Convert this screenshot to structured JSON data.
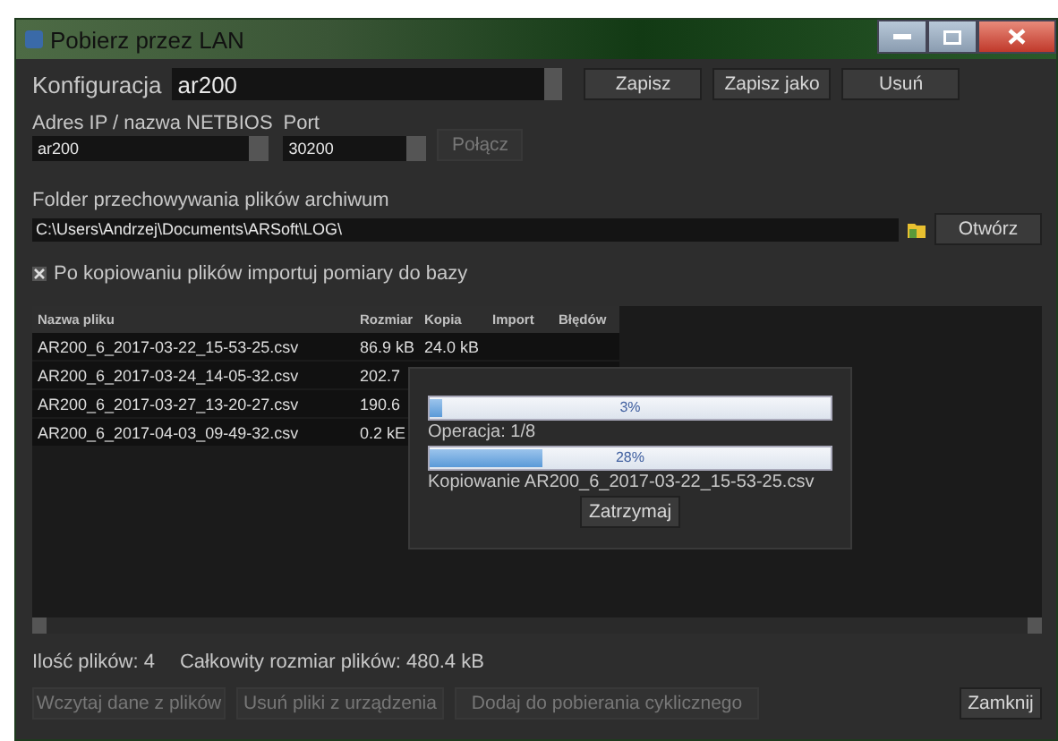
{
  "window": {
    "title": "Pobierz przez LAN"
  },
  "config": {
    "label": "Konfiguracja",
    "value": "ar200",
    "buttons": [
      {
        "label": "Zapisz",
        "disabled": false
      },
      {
        "label": "Zapisz jako",
        "disabled": false
      },
      {
        "label": "Usuń",
        "disabled": false
      }
    ]
  },
  "address": {
    "label": "Adres IP / nazwa NETBIOS",
    "value": "ar200"
  },
  "port": {
    "label": "Port",
    "value": "30200"
  },
  "connect_button": {
    "label": "Połącz",
    "disabled": true
  },
  "folder": {
    "label": "Folder przechowywania plików archiwum",
    "value": "C:\\Users\\Andrzej\\Documents\\ARSoft\\LOG\\",
    "open_button": "Otwórz"
  },
  "import_option": {
    "label": "Po kopiowaniu plików importuj pomiary do bazy",
    "checked": true
  },
  "table": {
    "columns": [
      "Nazwa pliku",
      "Rozmiar",
      "Kopia",
      "Import",
      "Błędów"
    ],
    "rows": [
      [
        "AR200_6_2017-03-22_15-53-25.csv",
        "86.9 kB",
        "24.0 kB",
        "",
        ""
      ],
      [
        "AR200_6_2017-03-24_14-05-32.csv",
        "202.7",
        "",
        "",
        ""
      ],
      [
        "AR200_6_2017-03-27_13-20-27.csv",
        "190.6",
        "",
        "",
        ""
      ],
      [
        "AR200_6_2017-04-03_09-49-32.csv",
        "0.2 kE",
        "",
        "",
        ""
      ]
    ]
  },
  "progress": {
    "overall": {
      "level": 0.03,
      "reading": "3%"
    },
    "operation": "Operacja: 1/8",
    "file": {
      "level": 0.28,
      "reading": "28%"
    },
    "status": "Kopiowanie AR200_6_2017-03-22_15-53-25.csv",
    "stop_button": "Zatrzymaj"
  },
  "status_bar": [
    {
      "text": "Ilość plików: 4"
    },
    {
      "text": "Całkowity rozmiar plików: 480.4 kB"
    }
  ],
  "footer_buttons": [
    {
      "label": "Wczytaj dane z plików",
      "disabled": true
    },
    {
      "label": "Usuń pliki z urządzenia",
      "disabled": true
    },
    {
      "label": "Dodaj do pobierania cyklicznego",
      "disabled": true
    }
  ],
  "close_button": {
    "label": "Zamknij",
    "disabled": false
  }
}
